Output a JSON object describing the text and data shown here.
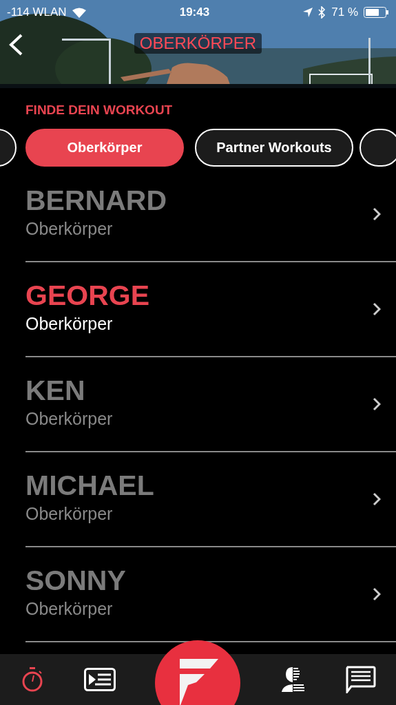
{
  "status_bar": {
    "carrier": "-114 WLAN",
    "time": "19:43",
    "battery": "71 %"
  },
  "header": {
    "title": "OBERKÖRPER",
    "kind": "picture"
  },
  "section_label": "FINDE DEIN WORKOUT",
  "filters": [
    {
      "label": "Oberkörper",
      "selected": true
    },
    {
      "label": "Partner Workouts",
      "selected": false
    }
  ],
  "workouts": [
    {
      "name": "BERNARD",
      "subtitle": "Oberkörper",
      "selected": false
    },
    {
      "name": "GEORGE",
      "subtitle": "Oberkörper",
      "selected": true
    },
    {
      "name": "KEN",
      "subtitle": "Oberkörper",
      "selected": false
    },
    {
      "name": "MICHAEL",
      "subtitle": "Oberkörper",
      "selected": false
    },
    {
      "name": "SONNY",
      "subtitle": "Oberkörper",
      "selected": false
    }
  ],
  "tab_bar": [
    {
      "kind": "timer",
      "selected": true
    },
    {
      "kind": "playlist",
      "selected": false
    },
    {
      "kind": "logo",
      "selected": false
    },
    {
      "kind": "profile",
      "selected": false
    },
    {
      "kind": "chat",
      "selected": false
    }
  ]
}
